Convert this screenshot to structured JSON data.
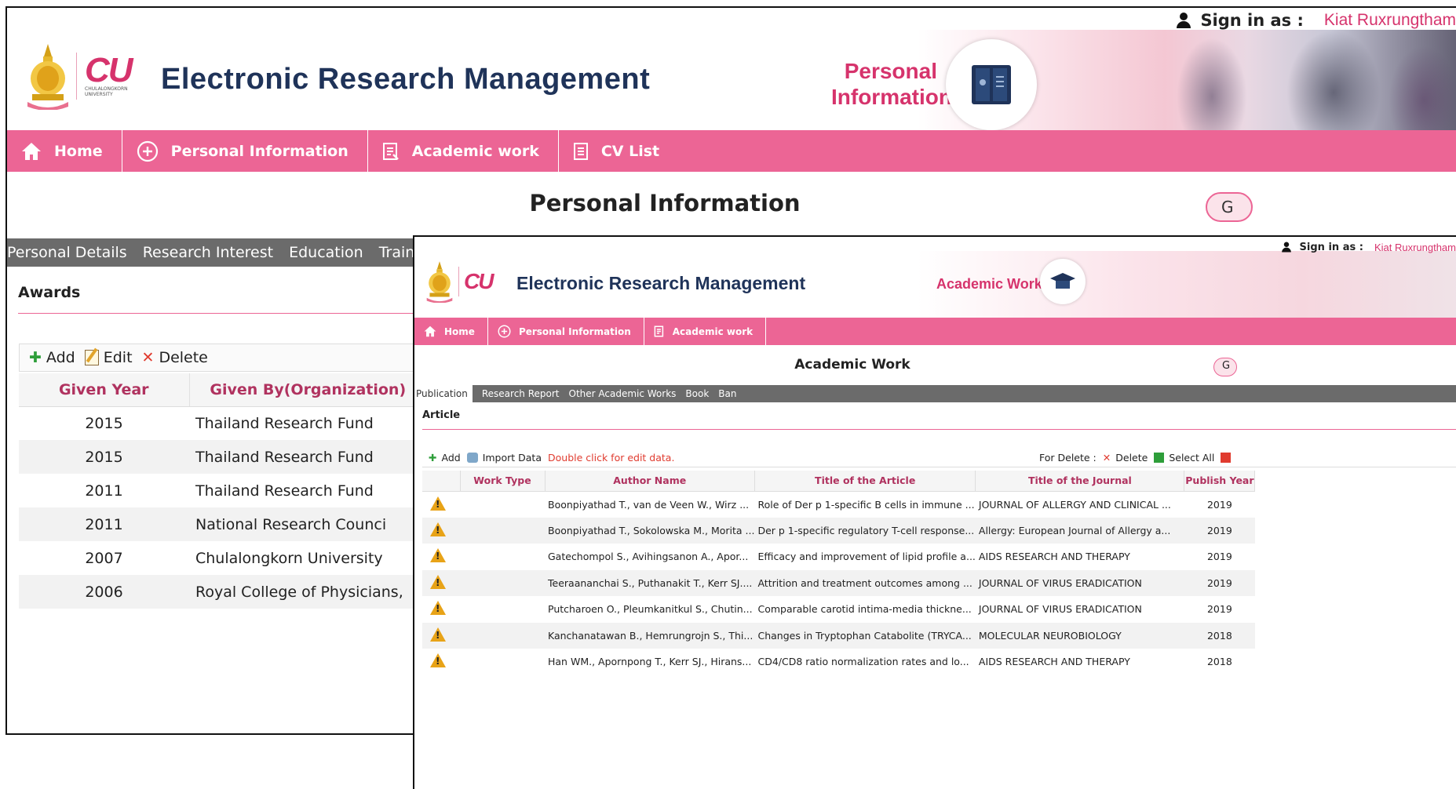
{
  "back": {
    "signin_label": "Sign in as :",
    "user": "Kiat Ruxrungtham",
    "app_title": "Electronic Research Management",
    "logo_text": "CU",
    "logo_sub": "CHULALONGKORN UNIVERSITY",
    "banner_label_line1": "Personal",
    "banner_label_line2": "Information",
    "nav": [
      {
        "label": "Home",
        "icon": "home-icon"
      },
      {
        "label": "Personal Information",
        "icon": "plus-circle-icon"
      },
      {
        "label": "Academic work",
        "icon": "document-icon"
      },
      {
        "label": "CV List",
        "icon": "list-icon"
      }
    ],
    "heading": "Personal Information",
    "g_button": "G",
    "tabs": [
      "Personal Details",
      "Research Interest",
      "Education",
      "Training"
    ],
    "section_title": "Awards",
    "toolbar": {
      "add": "Add",
      "edit": "Edit",
      "delete": "Delete"
    },
    "table": {
      "columns": [
        "Given Year",
        "Given By(Organization)"
      ],
      "rows": [
        [
          "2015",
          "Thailand Research Fund"
        ],
        [
          "2015",
          "Thailand Research Fund"
        ],
        [
          "2011",
          "Thailand Research Fund"
        ],
        [
          "2011",
          "National Research Counci"
        ],
        [
          "2007",
          "Chulalongkorn University"
        ],
        [
          "2006",
          "Royal College of Physicians,"
        ]
      ]
    }
  },
  "front": {
    "signin_label": "Sign in as :",
    "user": "Kiat Ruxrungtham",
    "app_title": "Electronic Research Management",
    "logo_text": "CU",
    "banner_label": "Academic Work",
    "nav": [
      {
        "label": "Home",
        "icon": "home-icon"
      },
      {
        "label": "Personal Information",
        "icon": "plus-circle-icon"
      },
      {
        "label": "Academic work",
        "icon": "document-icon"
      }
    ],
    "heading": "Academic Work",
    "g_button": "G",
    "tabs": [
      "Publication",
      "Research Report",
      "Other Academic Works",
      "Book",
      "Ban"
    ],
    "section_title": "Article",
    "toolbar": {
      "add": "Add",
      "import": "Import Data",
      "hint": "Double click for edit data.",
      "for_delete": "For Delete :",
      "delete": "Delete",
      "select_all": "Select All"
    },
    "table": {
      "columns": [
        "",
        "Work Type",
        "Author Name",
        "Title of the Article",
        "Title of the Journal",
        "Publish Year"
      ],
      "rows": [
        [
          "Boonpiyathad T., van de Veen W., Wirz ...",
          "Role of Der p 1-specific B cells in immune ...",
          "JOURNAL OF ALLERGY AND CLINICAL ...",
          "2019"
        ],
        [
          "Boonpiyathad T., Sokolowska M., Morita ...",
          "Der p 1-specific regulatory T-cell response...",
          "Allergy: European Journal of Allergy a...",
          "2019"
        ],
        [
          "Gatechompol S., Avihingsanon A., Apor...",
          "Efficacy and improvement of lipid profile a...",
          "AIDS RESEARCH AND THERAPY",
          "2019"
        ],
        [
          "Teeraananchai S., Puthanakit T., Kerr SJ....",
          "Attrition and treatment outcomes among ...",
          "JOURNAL OF VIRUS ERADICATION",
          "2019"
        ],
        [
          "Putcharoen O., Pleumkanitkul S., Chutin...",
          "Comparable carotid intima-media thickne...",
          "JOURNAL OF VIRUS ERADICATION",
          "2019"
        ],
        [
          "Kanchanatawan B., Hemrungrojn S., Thi...",
          "Changes in Tryptophan Catabolite (TRYCA...",
          "MOLECULAR NEUROBIOLOGY",
          "2018"
        ],
        [
          "Han WM., Apornpong T., Kerr SJ., Hirans...",
          "CD4/CD8 ratio normalization rates and lo...",
          "AIDS RESEARCH AND THERAPY",
          "2018"
        ]
      ]
    }
  },
  "colors": {
    "accent": "#ec6595",
    "title": "#1f3359",
    "header_text": "#b0325f",
    "tab_bar": "#6b6b6b",
    "user_name": "#d6336c"
  }
}
